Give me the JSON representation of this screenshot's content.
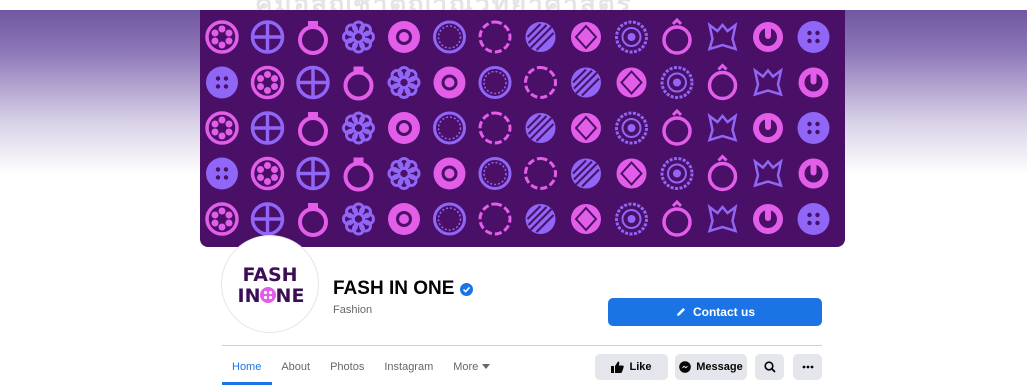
{
  "watermark": "คู่มือสัญชาตญาณวิทยาศาสตร์",
  "page": {
    "name": "FASH IN ONE",
    "category": "Fashion",
    "logo_line1": "FASH",
    "logo_line2a": "IN",
    "logo_line2b": "NE"
  },
  "contact": {
    "label": "Contact us",
    "icon": "pencil-icon"
  },
  "tabs": [
    {
      "label": "Home"
    },
    {
      "label": "About"
    },
    {
      "label": "Photos"
    },
    {
      "label": "Instagram"
    },
    {
      "label": "More"
    }
  ],
  "actions": {
    "like_label": "Like",
    "message_label": "Message"
  },
  "colors": {
    "brand": "#1b74e4",
    "cover_bg": "#4a0f67",
    "icon_pink": "#e35ee8",
    "icon_purple": "#8f66f5"
  }
}
